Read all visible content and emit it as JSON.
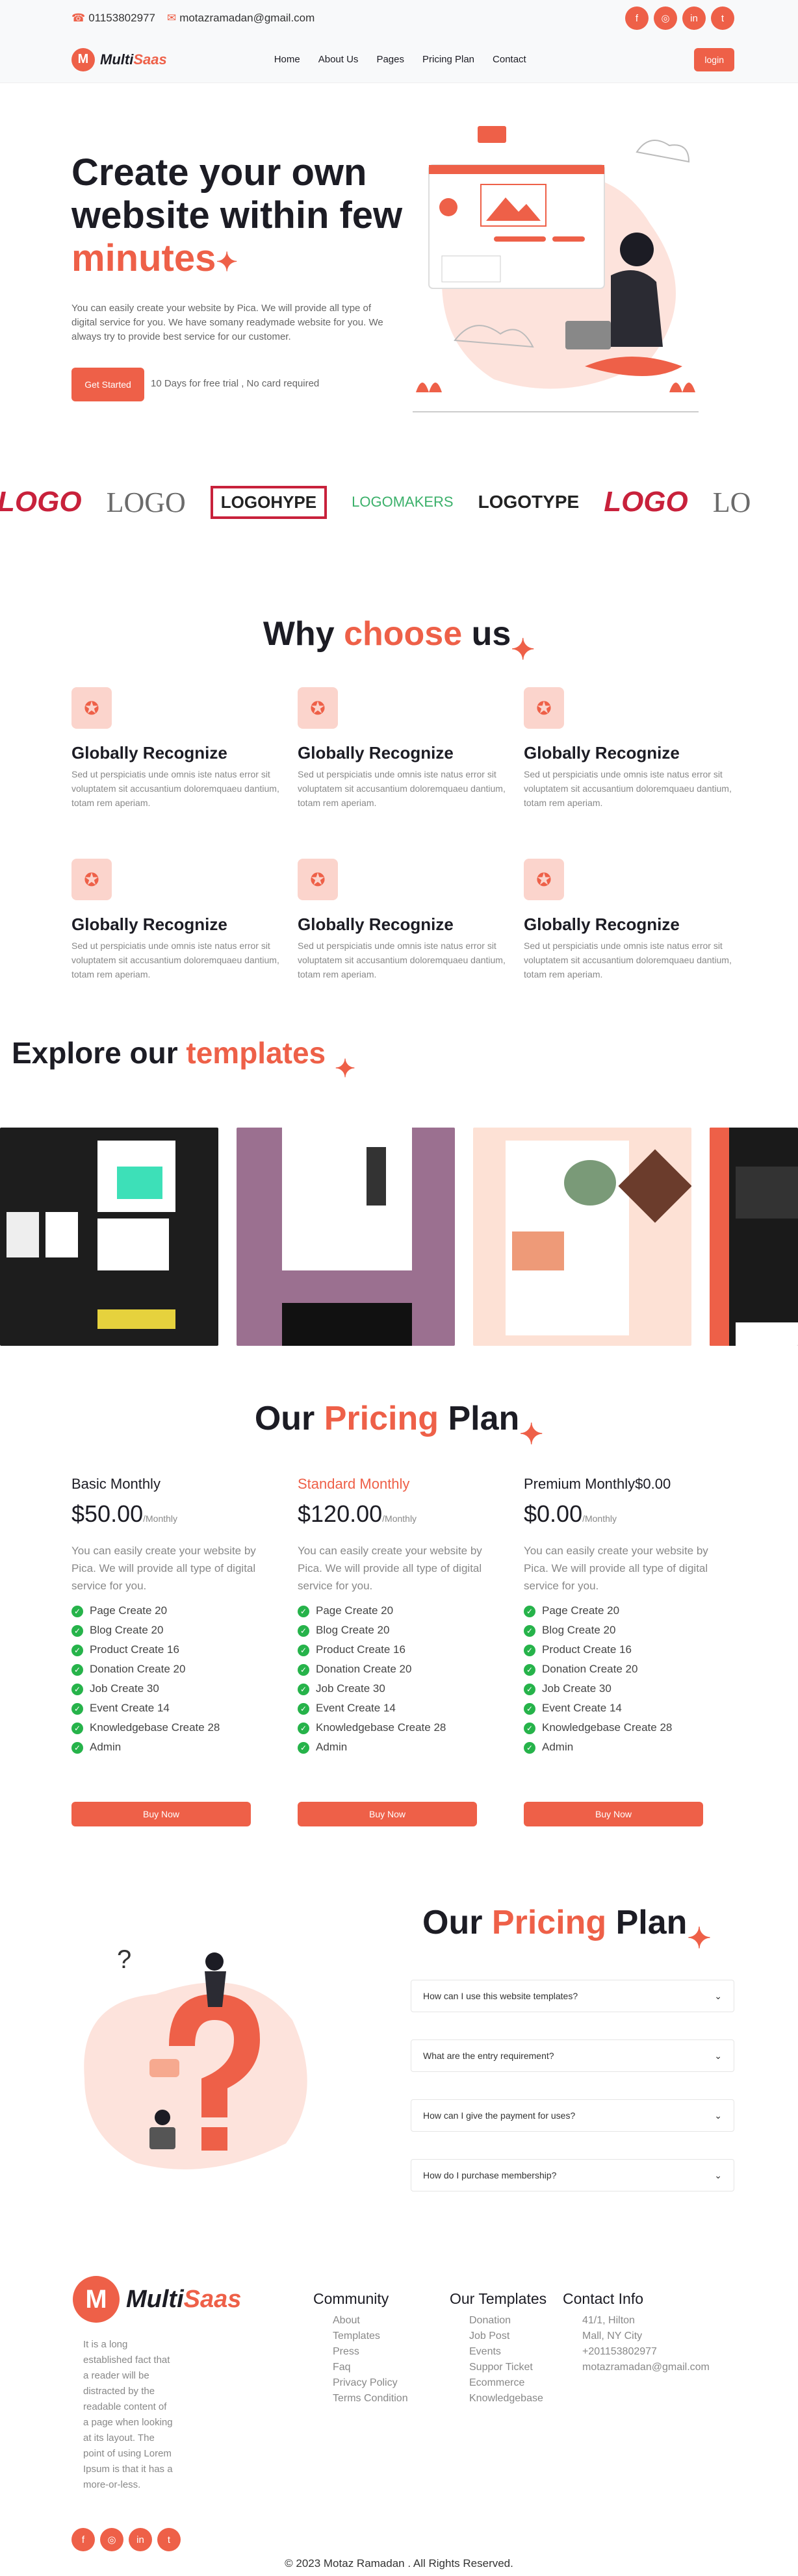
{
  "topbar": {
    "phone": "01153802977",
    "email": "motazramadan@gmail.com",
    "social": [
      "f",
      "◎",
      "in",
      "t"
    ]
  },
  "nav": {
    "logo_multi": "Multi",
    "logo_saas": "Saas",
    "items": [
      "Home",
      "About Us",
      "Pages",
      "Pricing Plan",
      "Contact"
    ],
    "login": "login"
  },
  "hero": {
    "title_line1": "Create your own",
    "title_line2": "website within few",
    "title_accent": "minutes",
    "desc": "You can easily create your website by Pica. We will provide all type of digital service for you. We have somany readymade website for you. We always try to provide best service for our customer.",
    "cta": "Get Started",
    "trial": "10 Days for free trial , No card required"
  },
  "logos": [
    "LOGO",
    "LOGO",
    "LOGOHYPE",
    "LOGOMAKERS",
    "LOGOTYPE",
    "LOGO",
    "LO"
  ],
  "why": {
    "t1": "Why",
    "t2": "choose",
    "t3": "us",
    "items": [
      {
        "title": "Globally Recognize",
        "desc": "Sed ut perspiciatis unde omnis iste natus error sit voluptatem sit accusantium doloremquaeu dantium, totam rem aperiam."
      },
      {
        "title": "Globally Recognize",
        "desc": "Sed ut perspiciatis unde omnis iste natus error sit voluptatem sit accusantium doloremquaeu dantium, totam rem aperiam."
      },
      {
        "title": "Globally Recognize",
        "desc": "Sed ut perspiciatis unde omnis iste natus error sit voluptatem sit accusantium doloremquaeu dantium, totam rem aperiam."
      },
      {
        "title": "Globally Recognize",
        "desc": "Sed ut perspiciatis unde omnis iste natus error sit voluptatem sit accusantium doloremquaeu dantium, totam rem aperiam."
      },
      {
        "title": "Globally Recognize",
        "desc": "Sed ut perspiciatis unde omnis iste natus error sit voluptatem sit accusantium doloremquaeu dantium, totam rem aperiam."
      },
      {
        "title": "Globally Recognize",
        "desc": "Sed ut perspiciatis unde omnis iste natus error sit voluptatem sit accusantium doloremquaeu dantium, totam rem aperiam."
      }
    ]
  },
  "templates": {
    "t1": "Explore our",
    "t2": "templates"
  },
  "pricing": {
    "t1": "Our",
    "t2": "Pricing",
    "t3": "Plan",
    "plans": [
      {
        "name": "Basic Monthly",
        "price": "$50.00",
        "per": "/Monthly",
        "desc": "You can easily create your website by Pica. We will provide all type of digital service for you.",
        "buy": "Buy Now"
      },
      {
        "name": "Standard Monthly",
        "price": "$120.00",
        "per": "/Monthly",
        "desc": "You can easily create your website by Pica. We will provide all type of digital service for you.",
        "buy": "Buy Now"
      },
      {
        "name": "Premium Monthly$0.00",
        "price": "$0.00",
        "per": "/Monthly",
        "desc": "You can easily create your website by Pica. We will provide all type of digital service for you.",
        "buy": "Buy Now"
      }
    ],
    "features": [
      "Page Create 20",
      "Blog Create 20",
      "Product Create 16",
      "Donation Create 20",
      "Job Create 30",
      "Event Create 14",
      "Knowledgebase Create 28",
      "Admin"
    ]
  },
  "faq": {
    "t1": "Our",
    "t2": "Pricing",
    "t3": "Plan",
    "q": [
      "How can I use this website templates?",
      "What are the entry requirement?",
      "How can I give the payment for uses?",
      "How do I purchase membership?"
    ]
  },
  "footer": {
    "about": "It is a long established fact that a reader will be distracted by the readable content of a page when looking at its layout. The point of using Lorem Ipsum is that it has a more-or-less.",
    "community": {
      "title": "Community",
      "links": [
        "About",
        "Templates",
        "Press",
        "Faq",
        "Privacy Policy",
        "Terms Condition"
      ]
    },
    "ourtemplates": {
      "title": "Our Templates",
      "links": [
        "Donation",
        "Job Post",
        "Events",
        "Suppor Ticket",
        "Ecommerce",
        "Knowledgebase"
      ]
    },
    "contact": {
      "title": "Contact Info",
      "lines": [
        "41/1, Hilton",
        "Mall, NY City",
        "+201153802977",
        "motazramadan@gmail.com"
      ]
    },
    "copyright": "© 2023 Motaz Ramadan . All Rights Reserved."
  },
  "colors": {
    "accent": "#ee6048",
    "check": "#26b34a"
  }
}
